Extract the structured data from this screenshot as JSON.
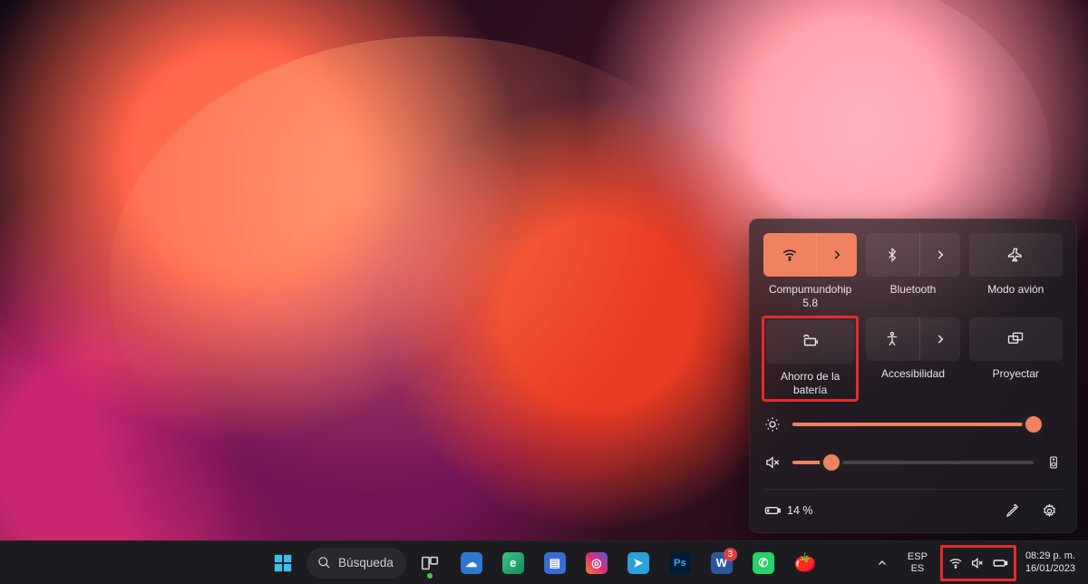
{
  "taskbar": {
    "search_placeholder": "Búsqueda",
    "apps": [
      {
        "name": "start",
        "color": "",
        "glyph": ""
      },
      {
        "name": "search",
        "color": "",
        "glyph": ""
      },
      {
        "name": "task-view",
        "color": "",
        "glyph": ""
      },
      {
        "name": "onedrive",
        "color": "#2f76d2",
        "glyph": "☁"
      },
      {
        "name": "edge-canary",
        "color": "#2aa36a",
        "glyph": "e"
      },
      {
        "name": "calculator",
        "color": "#3a6cd6",
        "glyph": "𝄜"
      },
      {
        "name": "instagram",
        "color": "linear-gradient(45deg,#f58529,#dd2a7b,#515bd4)",
        "glyph": "◎"
      },
      {
        "name": "telegram",
        "color": "#2aa1d8",
        "glyph": "➤"
      },
      {
        "name": "photoshop",
        "color": "#001d34",
        "glyph": "Ps"
      },
      {
        "name": "word",
        "color": "#2b579a",
        "glyph": "W",
        "badge": "3"
      },
      {
        "name": "whatsapp",
        "color": "#25d366",
        "glyph": "✆"
      },
      {
        "name": "pomodoro",
        "color": "#e5513b",
        "glyph": "🍅"
      }
    ],
    "lang_top": "ESP",
    "lang_bottom": "ES",
    "time": "08:29 p. m.",
    "date": "16/01/2023"
  },
  "quick_settings": {
    "tiles": [
      {
        "id": "wifi",
        "label": "Compumundohip 5.8",
        "active": true,
        "expandable": true
      },
      {
        "id": "bluetooth",
        "label": "Bluetooth",
        "active": false,
        "expandable": true
      },
      {
        "id": "airplane",
        "label": "Modo avión",
        "active": false,
        "expandable": false
      },
      {
        "id": "battery-saver",
        "label": "Ahorro de la batería",
        "active": false,
        "expandable": false,
        "highlighted": true
      },
      {
        "id": "accessibility",
        "label": "Accesibilidad",
        "active": false,
        "expandable": true
      },
      {
        "id": "project",
        "label": "Proyectar",
        "active": false,
        "expandable": false
      }
    ],
    "brightness_percent": 100,
    "volume_percent": 16,
    "volume_muted": true,
    "battery_text": "14 %"
  },
  "colors": {
    "accent": "#ee8261",
    "highlight": "#e52b2b"
  }
}
